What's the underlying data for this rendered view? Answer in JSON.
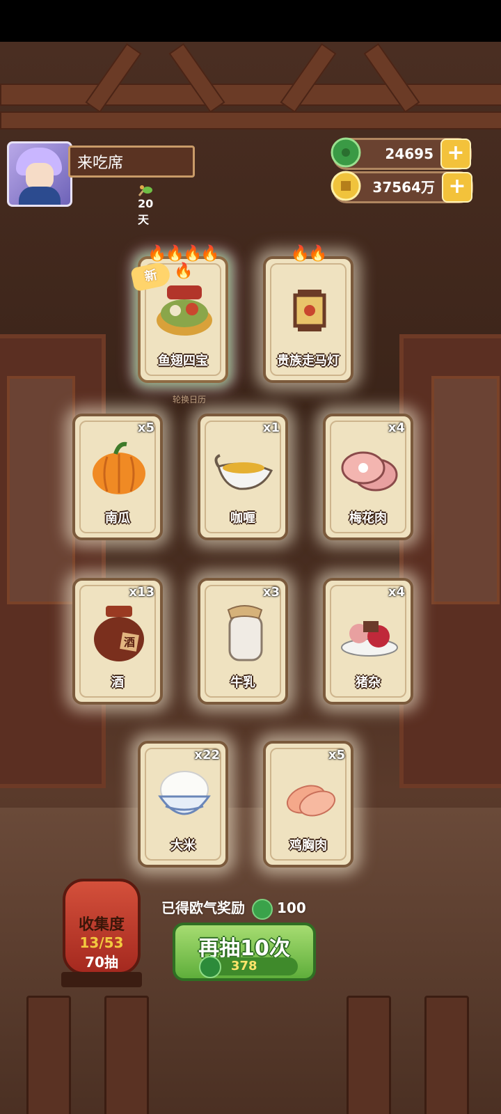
{
  "player": {
    "name": "来吃席",
    "days": "20天"
  },
  "resources": {
    "jade": "24695",
    "copper": "37564万"
  },
  "featured": [
    {
      "name": "鱼翅四宝",
      "flames": "🔥🔥🔥🔥🔥",
      "new": "新",
      "special": true
    },
    {
      "name": "贵族走马灯",
      "flames": "🔥🔥"
    }
  ],
  "calendar_label": "轮换日历",
  "cards": [
    {
      "name": "南瓜",
      "qty": "x5",
      "icon": "pumpkin-icon"
    },
    {
      "name": "咖喱",
      "qty": "x1",
      "icon": "curry-gravy-boat-icon"
    },
    {
      "name": "梅花肉",
      "qty": "x4",
      "icon": "pork-shoulder-icon"
    },
    {
      "name": "酒",
      "qty": "x13",
      "icon": "wine-jar-icon",
      "jar_label": "酒"
    },
    {
      "name": "牛乳",
      "qty": "x3",
      "icon": "milk-jar-icon"
    },
    {
      "name": "猪杂",
      "qty": "x4",
      "icon": "pork-offal-icon"
    },
    {
      "name": "大米",
      "qty": "x22",
      "icon": "rice-bowl-icon"
    },
    {
      "name": "鸡胸肉",
      "qty": "x5",
      "icon": "chicken-breast-icon"
    }
  ],
  "collection": {
    "label": "收集度",
    "progress": "13/53",
    "draws": "70抽"
  },
  "reward": {
    "label": "已得欧气奖励",
    "value": "100"
  },
  "draw_button": {
    "label": "再抽10次",
    "cost": "378"
  },
  "colors": {
    "wood": "#6b3b26",
    "card": "#efe2c0",
    "button_green": "#6fbf46",
    "gold": "#f3c23b"
  }
}
